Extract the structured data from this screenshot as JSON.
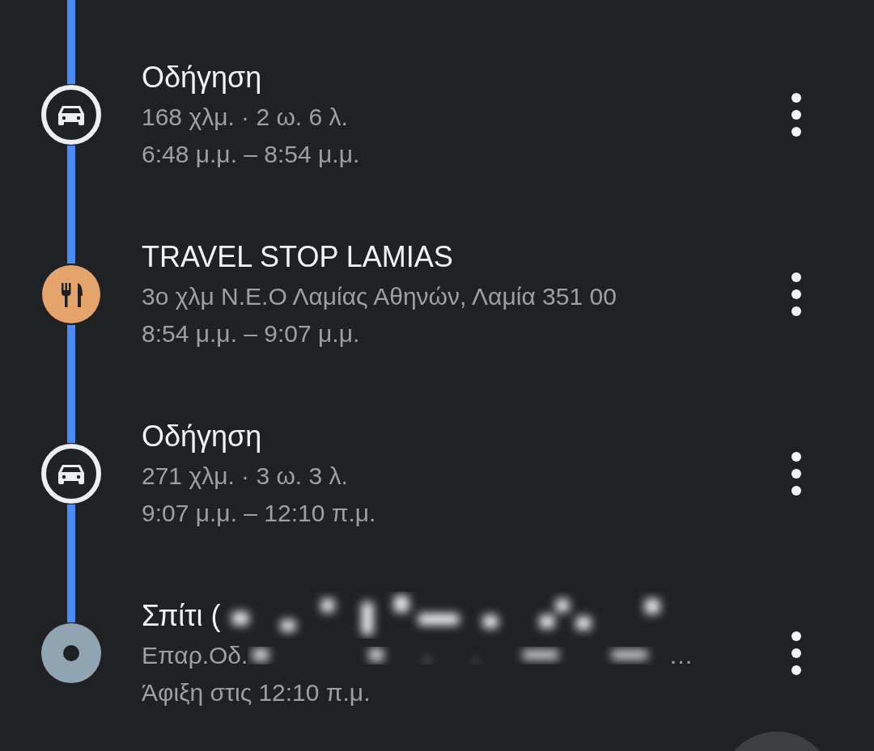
{
  "trip_steps": [
    {
      "kind": "drive",
      "title": "Οδήγηση",
      "lines": [
        "168 χλμ. · 2 ω. 6 λ.",
        "6:48 μ.μ. – 8:54 μ.μ."
      ]
    },
    {
      "kind": "stop",
      "title": "TRAVEL STOP LAMIAS",
      "lines": [
        "3ο χλμ Ν.Ε.Ο Λαμίας Αθηνών, Λαμία 351 00",
        "8:54 μ.μ. – 9:07 μ.μ."
      ]
    },
    {
      "kind": "drive",
      "title": "Οδήγηση",
      "lines": [
        "271 χλμ. · 3 ω. 3 λ.",
        "9:07 μ.μ. – 12:10 π.μ."
      ]
    },
    {
      "kind": "destination",
      "title": "Σπίτι (",
      "redacted": true,
      "address": "Επαρ.Οδ.",
      "address_end": "…",
      "lines": [
        "Άφιξη στις 12:10 π.μ."
      ]
    }
  ]
}
